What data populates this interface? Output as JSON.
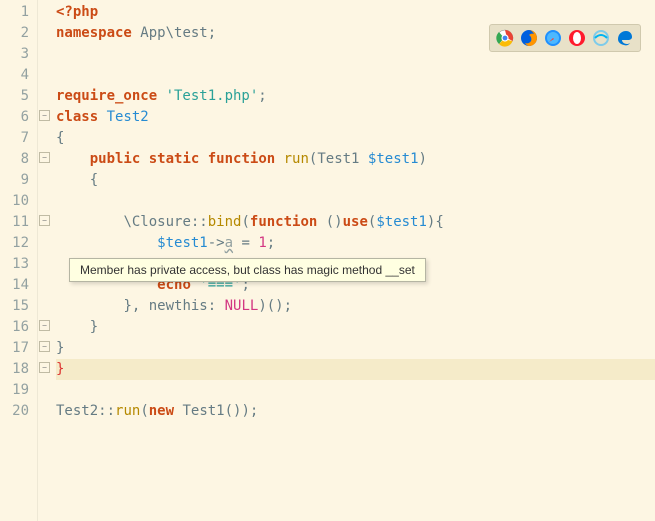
{
  "lines": {
    "l1": {
      "s1": "<?php"
    },
    "l2": {
      "s1": "namespace ",
      "s2": "App\\test",
      "s3": ";"
    },
    "l5": {
      "s1": "require_once ",
      "s2": "'Test1.php'",
      "s3": ";"
    },
    "l6": {
      "s1": "class ",
      "s2": "Test2"
    },
    "l7": {
      "s1": "{"
    },
    "l8": {
      "s1": "public ",
      "s2": "static ",
      "s3": "function ",
      "s4": "run",
      "s5": "(Test1 ",
      "s6": "$test1",
      "s7": ")"
    },
    "l9": {
      "s1": "{"
    },
    "l11": {
      "s1": "\\Closure",
      "s2": "::",
      "s3": "bind",
      "s4": "(",
      "s5": "function ",
      "s6": "()",
      "s7": "use",
      "s8": "(",
      "s9": "$test1",
      "s10": "){"
    },
    "l12": {
      "s1": "$test1",
      "s2": "->",
      "s3": "a",
      "s4": " = ",
      "s5": "1",
      "s6": ";"
    },
    "l14": {
      "s1": "echo ",
      "s2": "'==='",
      "s3": ";"
    },
    "l15": {
      "s1": "}, ",
      "s2": "newthis: ",
      "s3": "NULL",
      "s4": ")();"
    },
    "l16": {
      "s1": "}"
    },
    "l17": {
      "s1": "}"
    },
    "l18": {
      "s1": "}"
    },
    "l20": {
      "s1": "Test2",
      "s2": "::",
      "s3": "run",
      "s4": "(",
      "s5": "new ",
      "s6": "Test1",
      "s7": "());"
    }
  },
  "gutter": [
    "1",
    "2",
    "3",
    "4",
    "5",
    "6",
    "7",
    "8",
    "9",
    "10",
    "11",
    "12",
    "13",
    "14",
    "15",
    "16",
    "17",
    "18",
    "19",
    "20"
  ],
  "tooltip": {
    "text": "Member has private access, but class has magic method __set"
  },
  "browsers": [
    "chrome",
    "firefox",
    "safari",
    "opera",
    "ie",
    "edge"
  ]
}
